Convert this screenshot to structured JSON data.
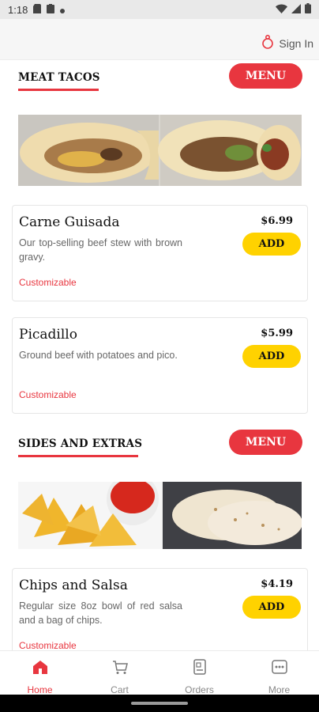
{
  "status_bar": {
    "time": "1:18"
  },
  "header": {
    "sign_in_label": "Sign In"
  },
  "sections": [
    {
      "title": "MEAT TACOS",
      "menu_label": "MENU",
      "items": [
        {
          "name": "Carne Guisada",
          "description": "Our top-selling beef stew with brown gravy.",
          "tag": "Customizable",
          "price": "$6.99",
          "add_label": "ADD"
        },
        {
          "name": "Picadillo",
          "description": "Ground beef with potatoes and pico.",
          "tag": "Customizable",
          "price": "$5.99",
          "add_label": "ADD"
        }
      ]
    },
    {
      "title": "SIDES AND EXTRAS",
      "menu_label": "MENU",
      "items": [
        {
          "name": "Chips and Salsa",
          "description": "Regular size 8oz bowl of red salsa and a bag of chips.",
          "tag": "Customizable",
          "price": "$4.19",
          "add_label": "ADD"
        }
      ]
    }
  ],
  "bottom_nav": [
    {
      "label": "Home",
      "icon": "home-icon",
      "active": true
    },
    {
      "label": "Cart",
      "icon": "cart-icon",
      "active": false
    },
    {
      "label": "Orders",
      "icon": "orders-icon",
      "active": false
    },
    {
      "label": "More",
      "icon": "more-icon",
      "active": false
    }
  ],
  "colors": {
    "accent": "#e8363f",
    "add_button": "#ffd200"
  }
}
